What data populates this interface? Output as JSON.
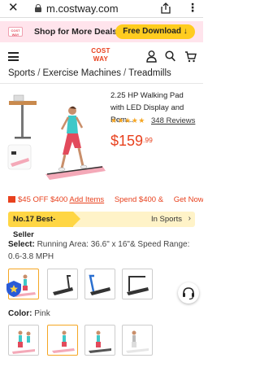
{
  "browser": {
    "url": "m.costway.com",
    "close_icon": "close-icon",
    "lock_icon": "lock-icon",
    "share_icon": "share-icon",
    "more_icon": "more-icon"
  },
  "promo": {
    "text": "Shop for More Deals",
    "button": "Free Download ↓"
  },
  "header": {
    "logo_line1": "COST",
    "logo_line2": "WAY",
    "icons": [
      "menu-icon",
      "user-icon",
      "search-icon",
      "cart-icon"
    ]
  },
  "breadcrumb": {
    "items": [
      "Sports",
      "Exercise Machines",
      "Treadmills"
    ],
    "separator": "/"
  },
  "product": {
    "title": "2.25 HP Walking Pad with LED Display and Rem...",
    "rating": 4.5,
    "stars": "★★★★★",
    "reviews": "348 Reviews",
    "price_main": "$159",
    "price_cents": ".99"
  },
  "coupons": {
    "items": [
      "$45 OFF $400",
      "Add Items",
      "Spend $400 &",
      "Get Now"
    ]
  },
  "best_seller": {
    "badge": "No.17 Best-Seller",
    "category": "In Sports",
    "chevron": "›"
  },
  "select": {
    "label": "Select:",
    "value": "Running Area: 36.6\" x 16\"& Speed Range: 0.6-3.8 MPH"
  },
  "color": {
    "label": "Color:",
    "value": "Pink"
  },
  "colors": {
    "accent": "#e8411e",
    "promo_bg": "#ffe4ec",
    "button_yellow": "#ffcc1f",
    "star": "#f5a623"
  }
}
